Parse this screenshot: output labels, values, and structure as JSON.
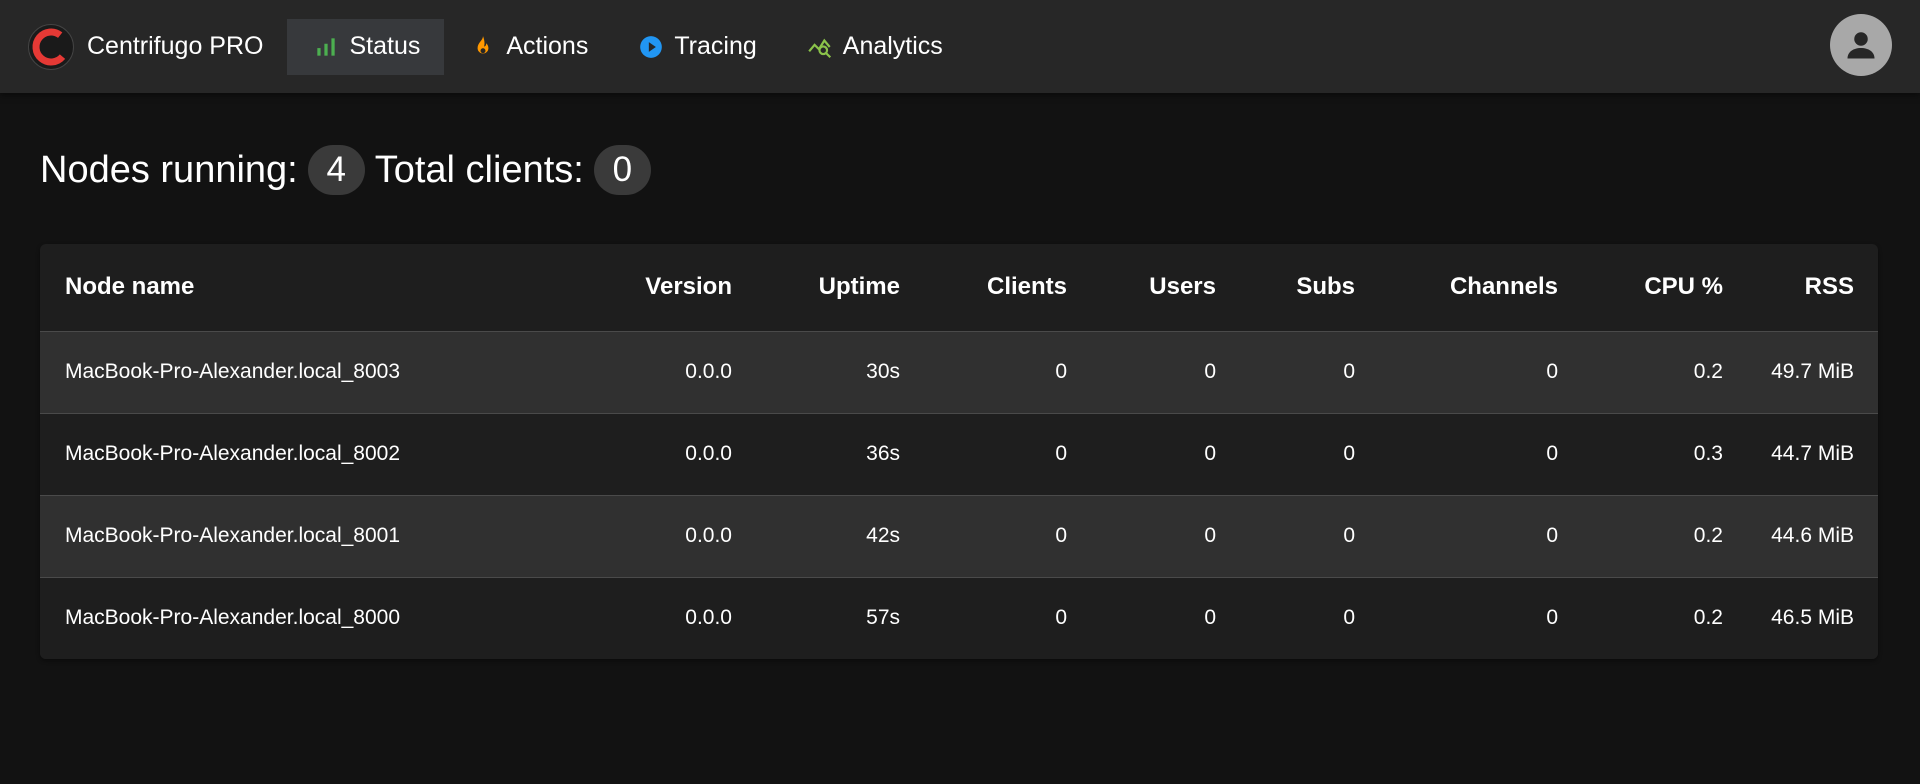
{
  "header": {
    "brand": "Centrifugo PRO",
    "nav": [
      {
        "label": "Status",
        "icon": "bar-chart-icon",
        "active": true
      },
      {
        "label": "Actions",
        "icon": "flame-icon",
        "active": false
      },
      {
        "label": "Tracing",
        "icon": "play-circle-icon",
        "active": false
      },
      {
        "label": "Analytics",
        "icon": "query-stats-icon",
        "active": false
      }
    ],
    "avatar_icon": "account-icon"
  },
  "summary": {
    "nodes_label": "Nodes running:",
    "nodes_count": "4",
    "clients_label": "Total clients:",
    "clients_count": "0"
  },
  "table": {
    "columns": [
      "Node name",
      "Version",
      "Uptime",
      "Clients",
      "Users",
      "Subs",
      "Channels",
      "CPU %",
      "RSS"
    ],
    "rows": [
      [
        "MacBook-Pro-Alexander.local_8003",
        "0.0.0",
        "30s",
        "0",
        "0",
        "0",
        "0",
        "0.2",
        "49.7 MiB"
      ],
      [
        "MacBook-Pro-Alexander.local_8002",
        "0.0.0",
        "36s",
        "0",
        "0",
        "0",
        "0",
        "0.3",
        "44.7 MiB"
      ],
      [
        "MacBook-Pro-Alexander.local_8001",
        "0.0.0",
        "42s",
        "0",
        "0",
        "0",
        "0",
        "0.2",
        "44.6 MiB"
      ],
      [
        "MacBook-Pro-Alexander.local_8000",
        "0.0.0",
        "57s",
        "0",
        "0",
        "0",
        "0",
        "0.2",
        "46.5 MiB"
      ]
    ]
  },
  "colors": {
    "topbar": "#272727",
    "active_nav": "#37393c",
    "background": "#121212",
    "status_icon": "#4caf50",
    "actions_icon": "#ff9800",
    "tracing_icon": "#2196f3",
    "analytics_icon": "#8bc34a",
    "logo_red": "#e53935"
  }
}
